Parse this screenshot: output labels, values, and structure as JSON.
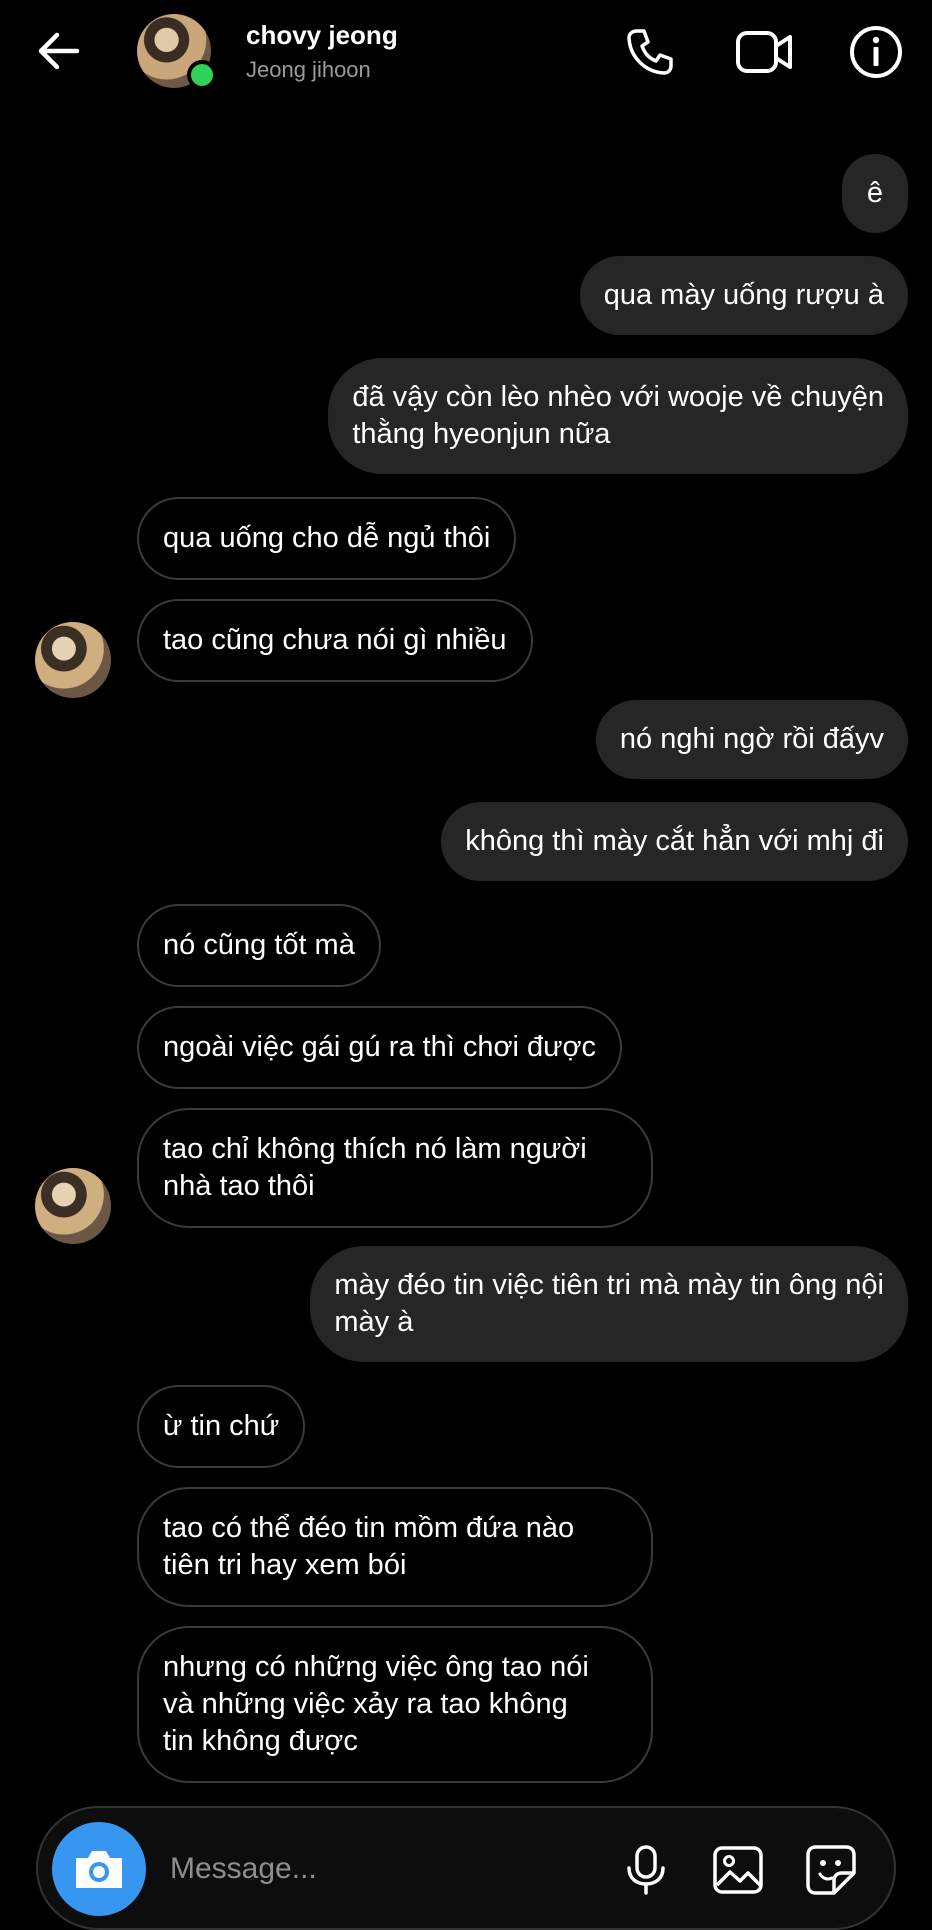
{
  "header": {
    "name": "chovy jeong",
    "username": "Jeong jihoon"
  },
  "messages": [
    {
      "side": "out",
      "text": "ê"
    },
    {
      "side": "out",
      "text": "qua mày uống rượu à"
    },
    {
      "side": "out",
      "text": "đã vậy còn lèo nhèo với wooje về chuyện\nthằng hyeonjun nữa"
    },
    {
      "side": "in",
      "text": "qua uống cho dễ ngủ thôi"
    },
    {
      "side": "in",
      "text": "tao cũng chưa nói gì nhiều"
    },
    {
      "side": "out",
      "text": "nó nghi ngờ rồi đấyv"
    },
    {
      "side": "out",
      "text": "không thì mày cắt hẳn với mhj đi"
    },
    {
      "side": "in",
      "text": "nó cũng tốt mà"
    },
    {
      "side": "in",
      "text": "ngoài việc gái gú ra thì chơi được"
    },
    {
      "side": "in",
      "text": "tao chỉ không thích nó làm người\nnhà tao thôi"
    },
    {
      "side": "out",
      "text": "mày đéo tin việc tiên tri mà mày tin ông nội\nmày à"
    },
    {
      "side": "in",
      "text": "ừ tin chứ"
    },
    {
      "side": "in",
      "text": "tao có thể đéo tin mồm đứa nào\ntiên tri hay xem bói"
    },
    {
      "side": "in",
      "text": "nhưng có những việc ông tao nói\nvà những việc xảy ra tao không\ntin không được"
    }
  ],
  "composer": {
    "placeholder": "Message..."
  },
  "icons": {
    "back": "arrow-left-icon",
    "call": "phone-icon",
    "video": "video-camera-icon",
    "info": "info-icon",
    "camera": "camera-icon",
    "mic": "microphone-icon",
    "gallery": "image-icon",
    "sticker": "sticker-icon"
  },
  "colors": {
    "background": "#000000",
    "outgoing_bubble": "#262626",
    "incoming_border": "#3a3a3a",
    "online": "#2fd158",
    "camera_button": "#3797f0"
  }
}
